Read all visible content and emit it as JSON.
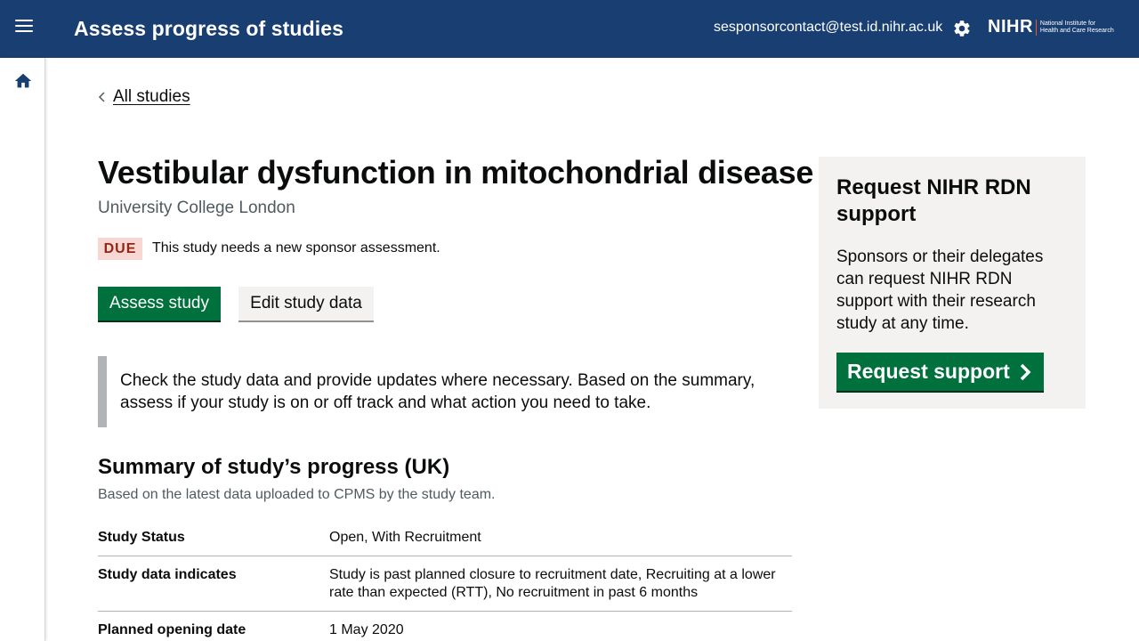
{
  "header": {
    "title": "Assess progress of studies",
    "user_email": "sesponsorcontact@test.id.nihr.ac.uk",
    "logo_text": "NIHR",
    "logo_sub1": "National Institute for",
    "logo_sub2": "Health and Care Research",
    "bg_color": "#193e72"
  },
  "icons": {
    "menu": "menu-icon",
    "settings": "gear-icon",
    "home": "home-icon",
    "back": "chevron-left-icon",
    "request": "chevron-right-icon"
  },
  "back_link": "All studies",
  "study": {
    "title": "Vestibular dysfunction in mitochondrial disease",
    "organisation": "University College London",
    "status_tag": "DUE",
    "status_text": "This study needs a new sponsor assessment."
  },
  "buttons": {
    "assess": "Assess study",
    "edit": "Edit study data",
    "request": "Request support"
  },
  "inset_text": "Check the study data and provide updates where necessary. Based on the summary, assess if your study is on or off track and what action you need to take.",
  "summary": {
    "heading": "Summary of study’s progress (UK)",
    "subheading": "Based on the latest data uploaded to CPMS by the study team.",
    "rows": [
      {
        "key": "Study Status",
        "value": "Open, With Recruitment"
      },
      {
        "key": "Study data indicates",
        "value": "Study is past planned closure to recruitment date, Recruiting at a lower rate than expected (RTT), No recruitment in past 6 months"
      },
      {
        "key": "Planned opening date",
        "value": "1 May 2020"
      }
    ]
  },
  "side_panel": {
    "heading": "Request NIHR RDN support",
    "body": "Sponsors or their delegates can request NIHR RDN support with their research study at any time."
  },
  "colors": {
    "primary_green": "#00703c",
    "tag_bg": "#f6d7d2",
    "tag_text": "#942514"
  }
}
